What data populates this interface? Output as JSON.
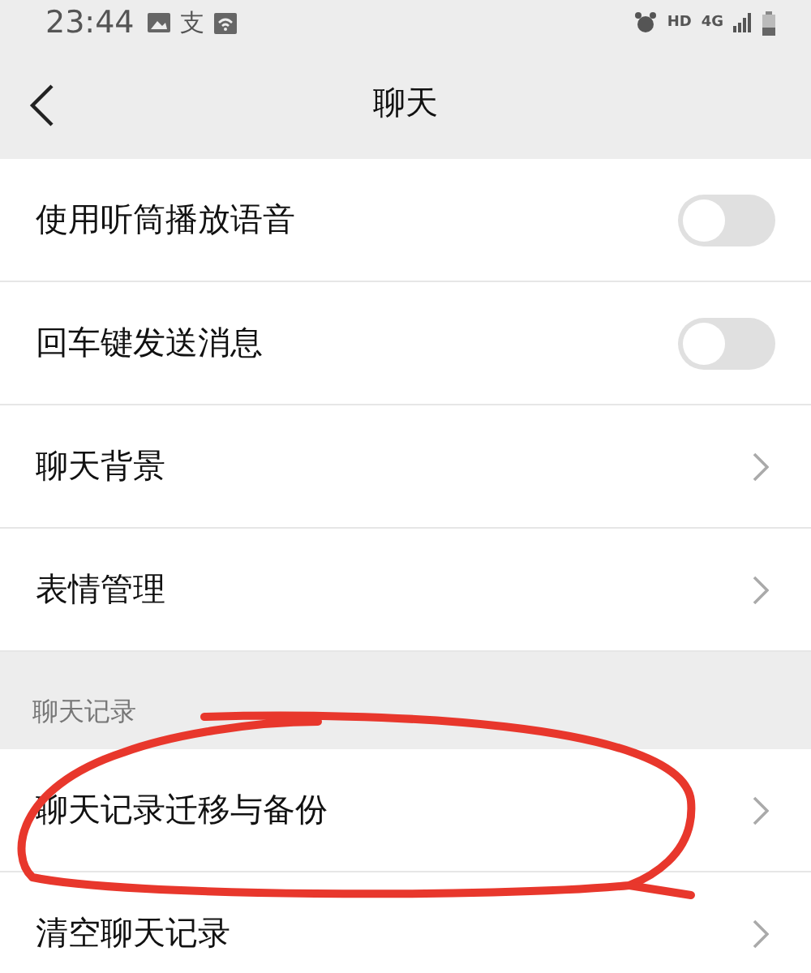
{
  "status_bar": {
    "time": "23:44",
    "app_glyph": "支",
    "hd": "HD",
    "network": "4G"
  },
  "header": {
    "title": "聊天"
  },
  "groups": [
    {
      "items": [
        {
          "label": "使用听筒播放语音",
          "kind": "toggle",
          "on": false
        },
        {
          "label": "回车键发送消息",
          "kind": "toggle",
          "on": false
        },
        {
          "label": "聊天背景",
          "kind": "link"
        },
        {
          "label": "表情管理",
          "kind": "link"
        }
      ]
    },
    {
      "title": "聊天记录",
      "items": [
        {
          "label": "聊天记录迁移与备份",
          "kind": "link"
        },
        {
          "label": "清空聊天记录",
          "kind": "link"
        }
      ]
    }
  ]
}
